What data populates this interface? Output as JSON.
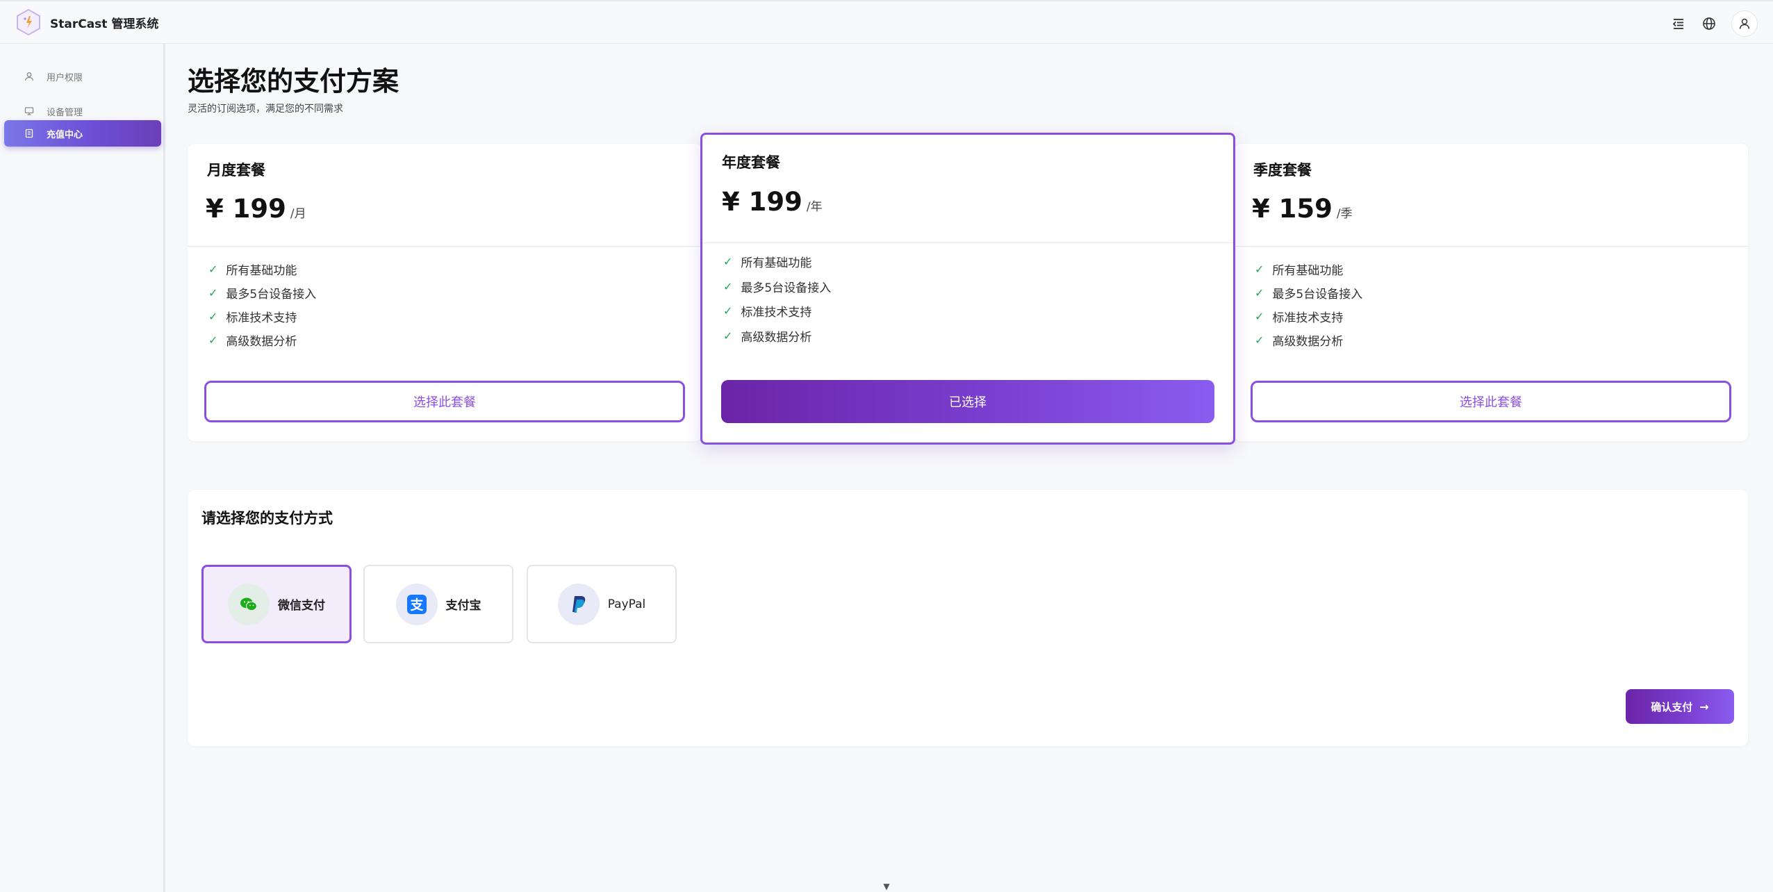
{
  "app": {
    "name": "StarCast 管理系统"
  },
  "header": {
    "icons": [
      "menu-collapse-icon",
      "globe-icon",
      "user-icon"
    ]
  },
  "sidebar": {
    "items": [
      {
        "label": "用户权限",
        "icon": "user-icon",
        "active": false
      },
      {
        "label": "设备管理",
        "icon": "monitor-icon",
        "active": false
      },
      {
        "label": "充值中心",
        "icon": "receipt-icon",
        "active": true
      }
    ]
  },
  "page": {
    "title": "选择您的支付方案",
    "subtitle": "灵活的订阅选项，满足您的不同需求"
  },
  "plans": [
    {
      "name": "月度套餐",
      "price": "¥ 199",
      "period": "/月",
      "features": [
        "所有基础功能",
        "最多5台设备接入",
        "标准技术支持",
        "高级数据分析"
      ],
      "button": "选择此套餐",
      "selected": false
    },
    {
      "name": "年度套餐",
      "price": "¥ 199",
      "period": "/年",
      "features": [
        "所有基础功能",
        "最多5台设备接入",
        "标准技术支持",
        "高级数据分析"
      ],
      "button": "已选择",
      "selected": true
    },
    {
      "name": "季度套餐",
      "price": "¥ 159",
      "period": "/季",
      "features": [
        "所有基础功能",
        "最多5台设备接入",
        "标准技术支持",
        "高级数据分析"
      ],
      "button": "选择此套餐",
      "selected": false
    }
  ],
  "payment": {
    "title": "请选择您的支付方式",
    "methods": [
      {
        "label": "微信支付",
        "icon": "wechat-icon",
        "selected": true
      },
      {
        "label": "支付宝",
        "icon": "alipay-icon",
        "selected": false
      },
      {
        "label": "PayPal",
        "icon": "paypal-icon",
        "selected": false
      }
    ],
    "confirm": "确认支付",
    "confirm_arrow": "→"
  },
  "colors": {
    "accent": "#8a4fe0",
    "accent_dark": "#6b24a8",
    "check": "#1fa85a",
    "wechat": "#1aad19",
    "alipay": "#1677ff",
    "paypal": "#253b80"
  }
}
